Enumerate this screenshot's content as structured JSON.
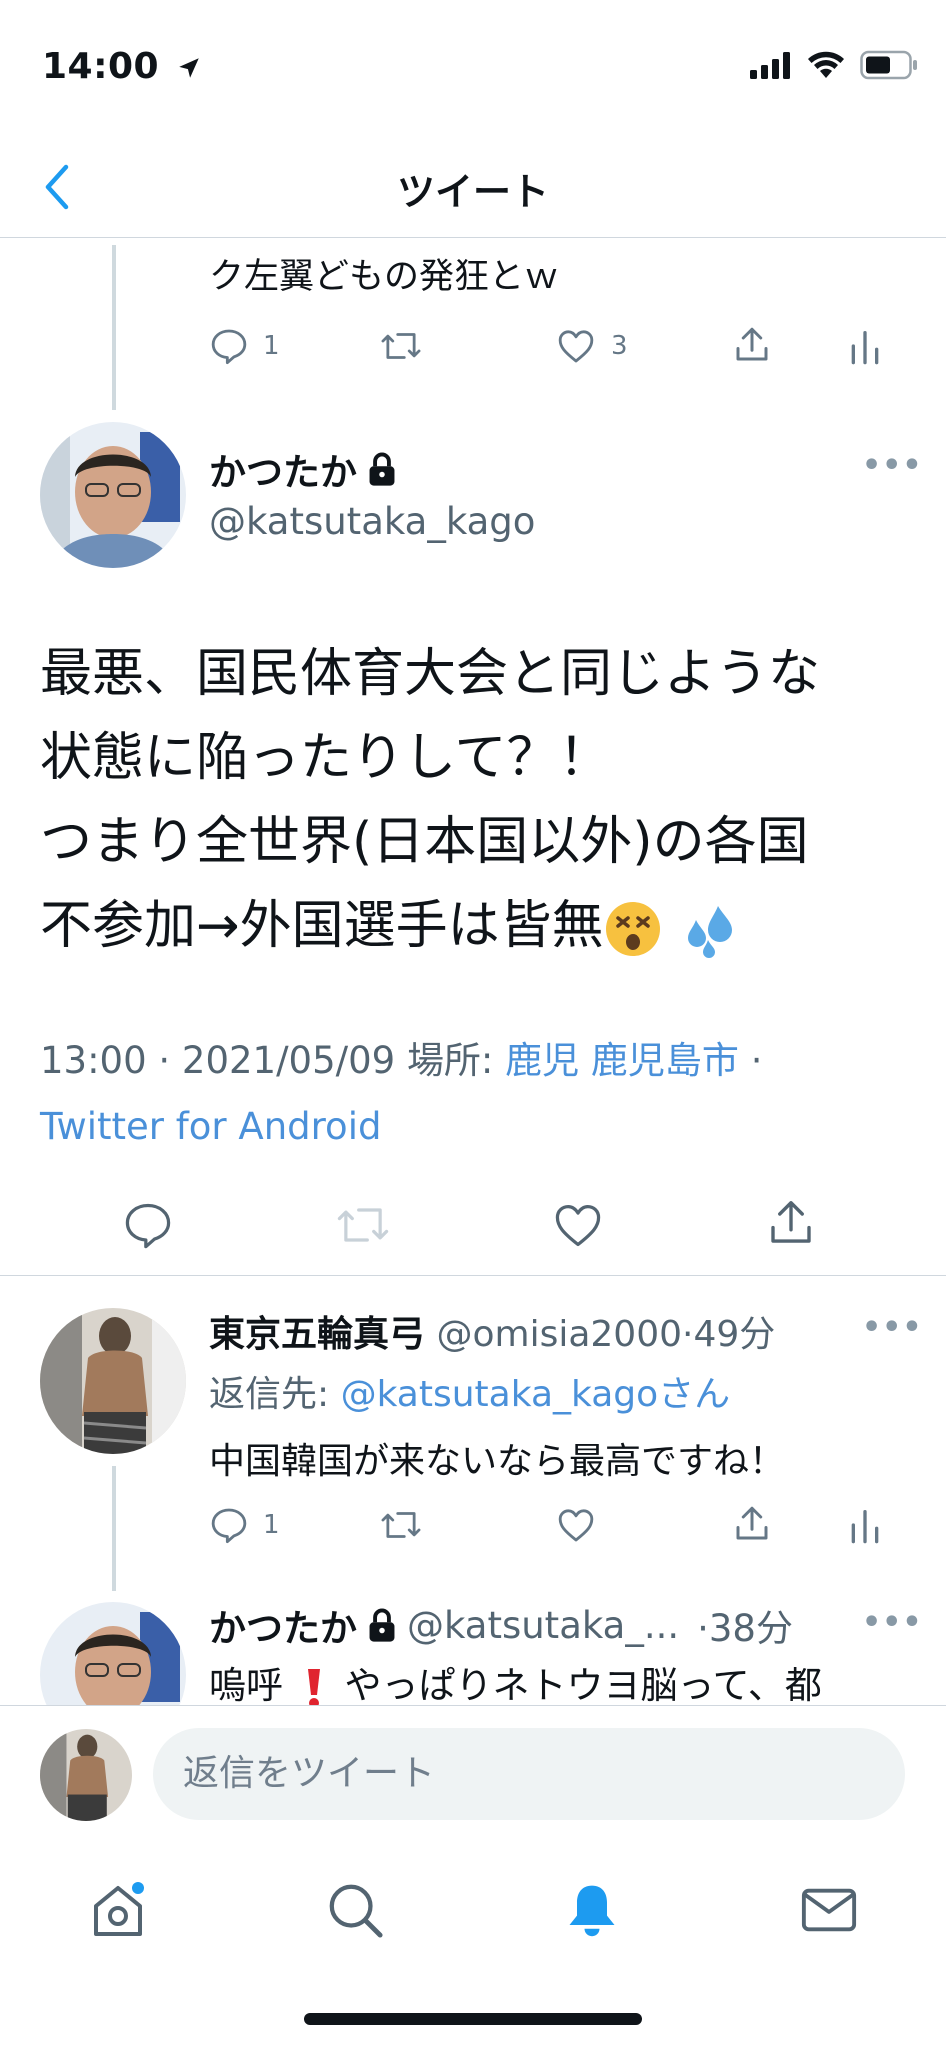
{
  "status_bar": {
    "time": "14:00"
  },
  "nav": {
    "title": "ツイート"
  },
  "parent_tweet": {
    "text": "ク左翼どもの発狂とｗ",
    "reply_count": "1",
    "like_count": "3"
  },
  "main_tweet": {
    "author_name": "かつたか",
    "author_handle": "@katsutaka_kago",
    "lines": [
      "最悪、国民体育大会と同じような",
      "状態に陥ったりして？！",
      "つまり全世界(日本国以外)の各国",
      "不参加→外国選手は皆無"
    ],
    "timestamp": "13:00 · 2021/05/09",
    "location_label": "場所:",
    "location": "鹿児 鹿児島市",
    "separator": "·",
    "source": "Twitter for Android"
  },
  "reply_1": {
    "author_name": "東京五輪真弓",
    "author_handle": "@omisia2000",
    "time": "·49分",
    "reply_to_label": "返信先:",
    "reply_to": "@katsutaka_kagoさん",
    "text": "中国韓国が来ないなら最高ですね！",
    "reply_count": "1"
  },
  "reply_2": {
    "author_name": "かつたか",
    "author_handle": "@katsutaka_...",
    "time": "·38分",
    "text_before": "嗚呼",
    "text_after": "やっぱりネトウヨ脳って、都"
  },
  "compose": {
    "placeholder": "返信をツイート"
  },
  "colors": {
    "accent": "#1d9bf0",
    "link": "#4a90d9",
    "muted": "#536471"
  }
}
